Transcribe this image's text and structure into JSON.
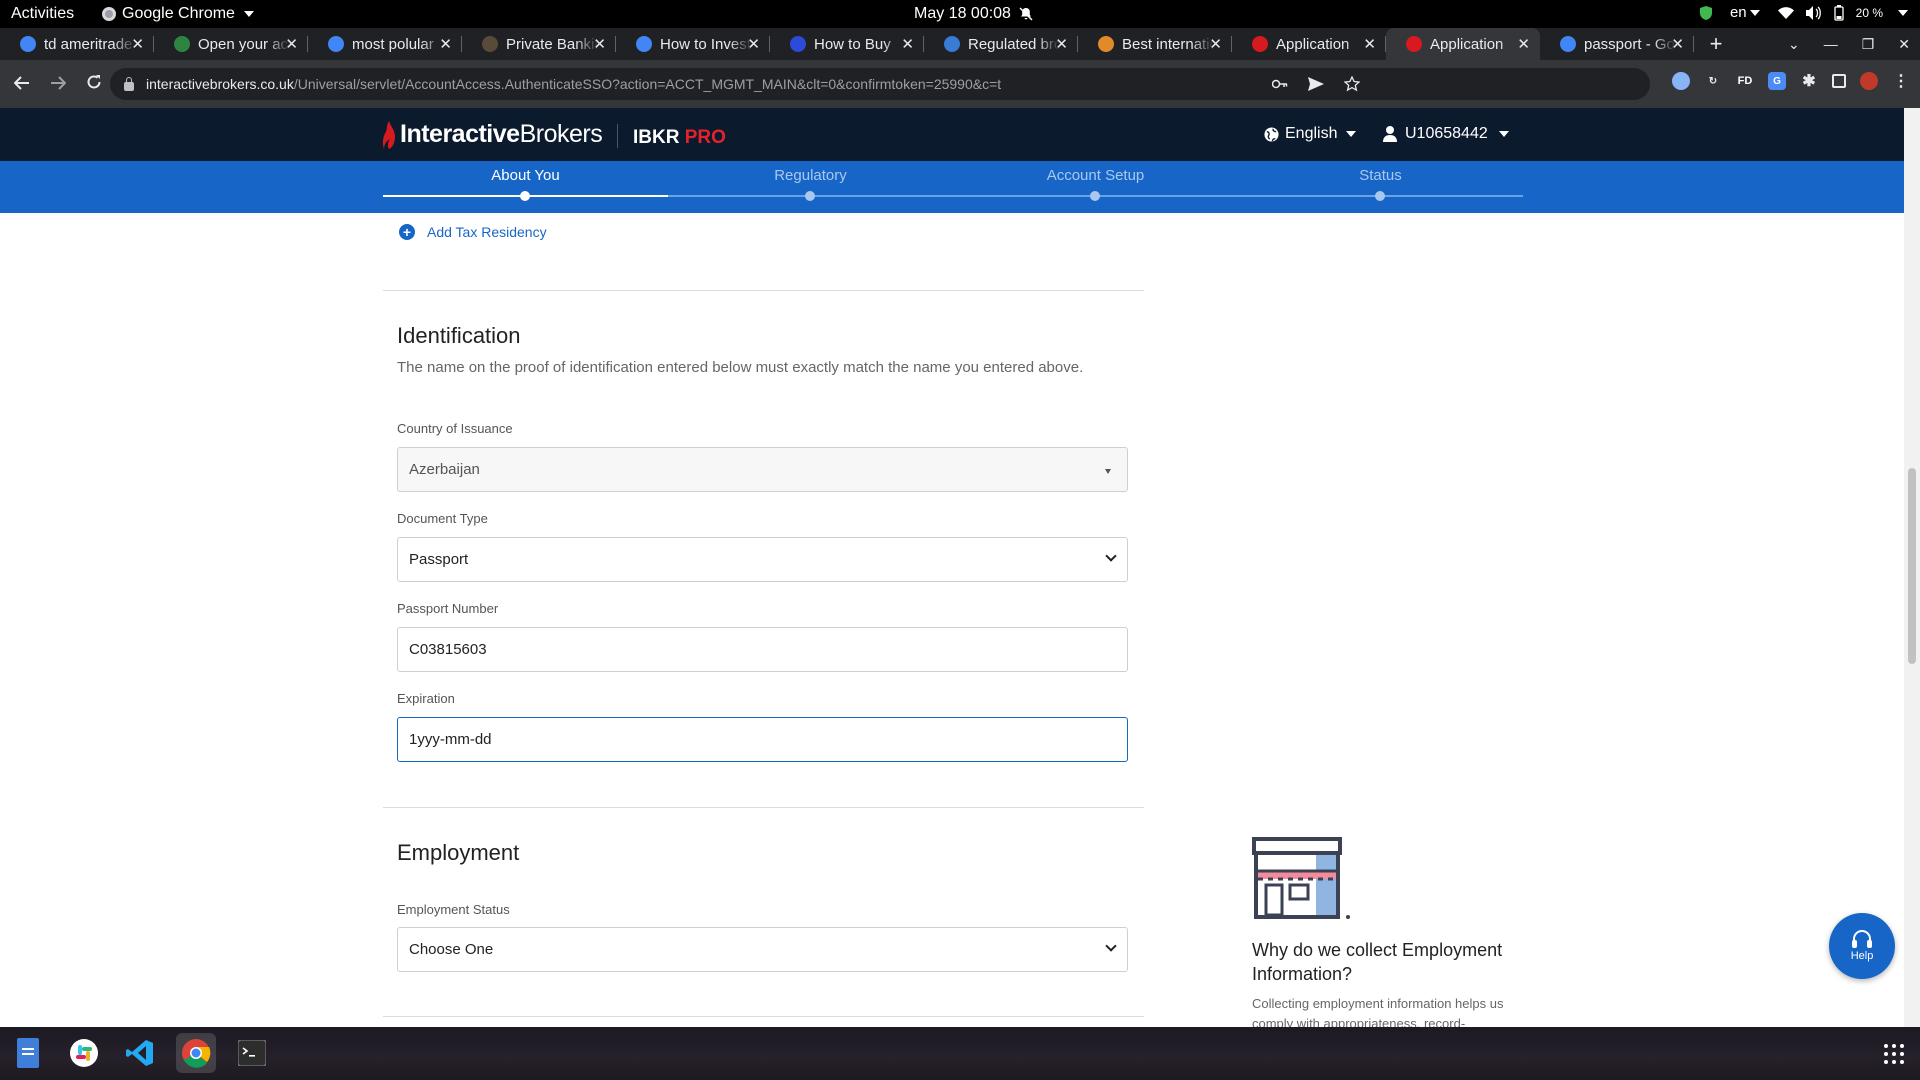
{
  "system": {
    "activities": "Activities",
    "app_name": "Google Chrome",
    "clock": "May 18  00:08",
    "lang": "en",
    "battery": "20 %"
  },
  "tabs": [
    {
      "title": "td ameritrade",
      "favicon": "google-icon",
      "color": "#4285f4",
      "active": false
    },
    {
      "title": "Open your account",
      "favicon": "td-icon",
      "color": "#2e8540",
      "active": false
    },
    {
      "title": "most polular",
      "favicon": "google-icon",
      "color": "#4285f4",
      "active": false
    },
    {
      "title": "Private Banking",
      "favicon": "bank-icon",
      "color": "#5a4a3a",
      "active": false
    },
    {
      "title": "How to Invest",
      "favicon": "google-icon",
      "color": "#4285f4",
      "active": false
    },
    {
      "title": "How to Buy",
      "favicon": "circle-icon",
      "color": "#2b4bd8",
      "active": false
    },
    {
      "title": "Regulated brokers",
      "favicon": "broker-icon",
      "color": "#3a7bd5",
      "active": false
    },
    {
      "title": "Best international",
      "favicon": "infinity-icon",
      "color": "#e08a2a",
      "active": false
    },
    {
      "title": "Application",
      "favicon": "ib-icon",
      "color": "#d71920",
      "active": false
    },
    {
      "title": "Application",
      "favicon": "ib-icon",
      "color": "#d71920",
      "active": true
    },
    {
      "title": "passport - Google",
      "favicon": "google-icon",
      "color": "#4285f4",
      "active": false
    }
  ],
  "address_bar": {
    "host": "interactivebrokers.co.uk",
    "path": "/Universal/servlet/AccountAccess.AuthenticateSSO?action=ACCT_MGMT_MAIN&clt=0&confirmtoken=25990&c=t"
  },
  "ib_header": {
    "brand_bold": "Interactive",
    "brand_regular": "Brokers",
    "ibkr": "IBKR",
    "pro": "PRO",
    "language": "English",
    "account_id": "U10658442"
  },
  "steps": [
    {
      "label": "About You",
      "current": true
    },
    {
      "label": "Regulatory",
      "current": false
    },
    {
      "label": "Account Setup",
      "current": false
    },
    {
      "label": "Status",
      "current": false
    }
  ],
  "form": {
    "add_tax_residency": "Add Tax Residency",
    "identification": {
      "title": "Identification",
      "description": "The name on the proof of identification entered below must exactly match the name you entered above.",
      "country_label": "Country of Issuance",
      "country_value": "Azerbaijan",
      "doc_type_label": "Document Type",
      "doc_type_value": "Passport",
      "passport_label": "Passport Number",
      "passport_value": "C03815603",
      "expiration_label": "Expiration",
      "expiration_value": "1yyy-mm-dd"
    },
    "employment": {
      "title": "Employment",
      "status_label": "Employment Status",
      "status_value": "Choose One"
    }
  },
  "sidebar_info": {
    "title": "Why do we collect Employment Information?",
    "text": "Collecting employment information helps us comply with appropriateness, record-"
  },
  "help_label": "Help"
}
